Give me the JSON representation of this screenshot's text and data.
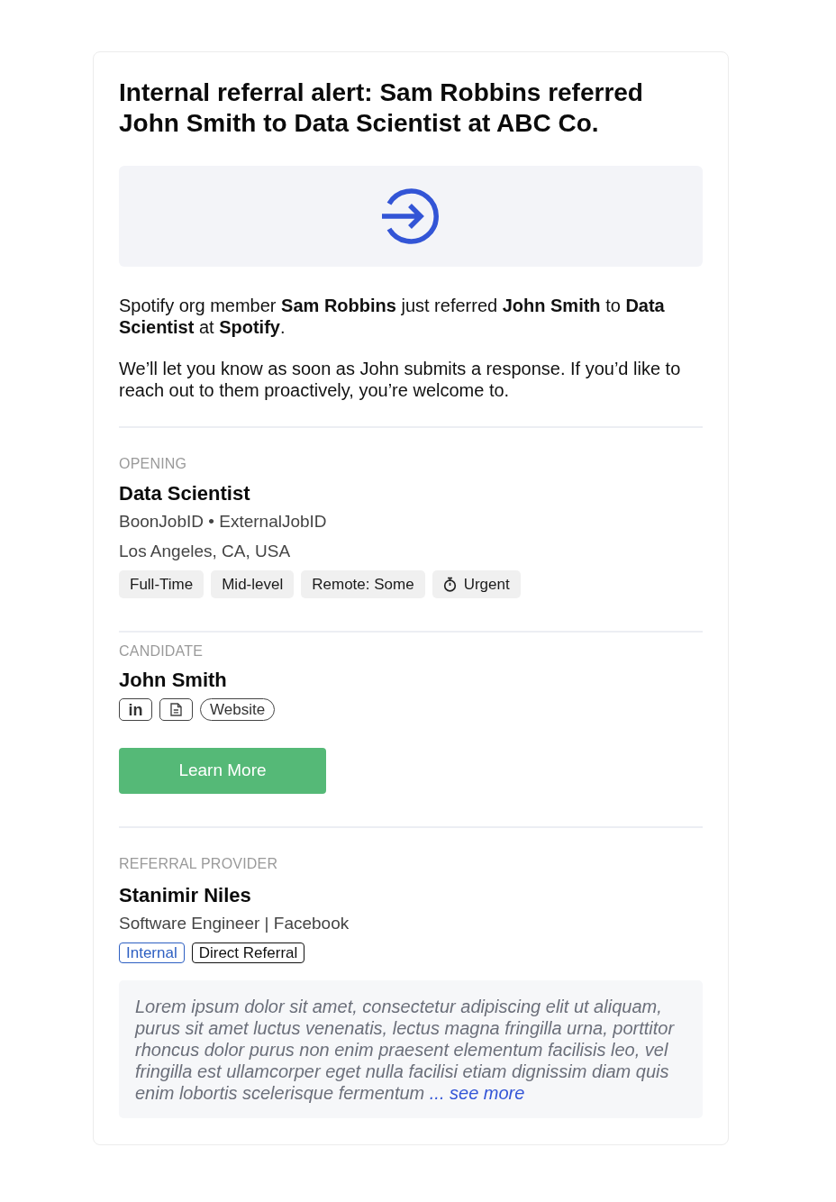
{
  "title": "Internal referral alert: Sam Robbins referred John Smith to Data Scientist at ABC Co.",
  "intro": "Spotify org member **Sam Robbins** just referred **John Smith** to **Data Scientist** at **Spotify**.",
  "note": "We’ll let you know as soon as John submits a response. If you’d like to reach out to them proactively, you’re welcome to.",
  "opening": {
    "label": "OPENING",
    "title": "Data Scientist",
    "job_ids": "BoonJobID • ExternalJobID",
    "location": "Los Angeles, CA, USA",
    "tags": [
      {
        "text": "Full-Time",
        "kind": "plain"
      },
      {
        "text": "Mid-level",
        "kind": "plain"
      },
      {
        "text": "Remote: Some",
        "kind": "plain"
      },
      {
        "text": "Urgent",
        "kind": "timer"
      }
    ]
  },
  "candidate": {
    "label": "CANDIDATE",
    "name": "John Smith",
    "links": [
      {
        "kind": "logo",
        "text": "in"
      },
      {
        "kind": "document"
      },
      {
        "kind": "pill",
        "text": "Website"
      }
    ]
  },
  "action": {
    "label": "Learn More"
  },
  "referrer": {
    "label": "REFERRAL PROVIDER",
    "name": "Stanimir Niles",
    "role": "Software Engineer | Facebook",
    "badges": [
      {
        "text": "Internal",
        "color": "#2d5fc2"
      },
      {
        "text": "Direct Referral",
        "color": "#111111"
      }
    ],
    "comment": "Lorem ipsum dolor sit amet, consectetur adipiscing elit ut aliquam, purus sit amet luctus venenatis, lectus magna fringilla urna, porttitor rhoncus dolor purus non enim praesent elementum facilisis leo, vel fringilla est ullamcorper eget nulla facilisi etiam dignissim diam quis enim lobortis scelerisque fermentum",
    "more": "... see more"
  }
}
